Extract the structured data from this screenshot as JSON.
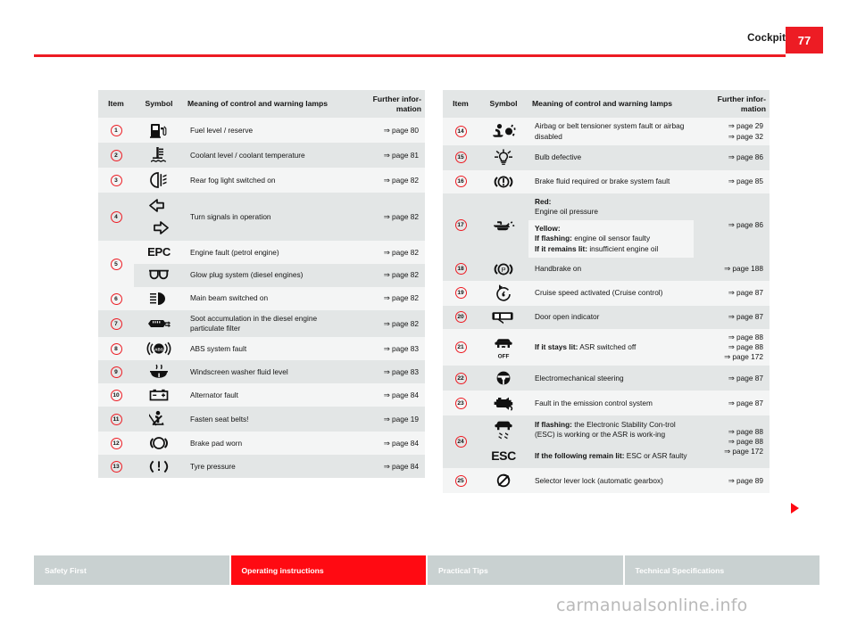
{
  "header": {
    "title": "Cockpit",
    "page_number": "77"
  },
  "columns": {
    "item": "Item",
    "symbol": "Symbol",
    "meaning": "Meaning of control and warning lamps",
    "further": "Further infor-\nmation",
    "further_line1": "Further infor-",
    "further_line2": "mation"
  },
  "left_rows": [
    {
      "item": "1",
      "icon": "fuel-pump-icon",
      "meaning": "Fuel level / reserve",
      "refs": [
        "⇒ page 80"
      ]
    },
    {
      "item": "2",
      "icon": "coolant-temp-icon",
      "meaning": "Coolant level / coolant temperature",
      "refs": [
        "⇒ page 81"
      ]
    },
    {
      "item": "3",
      "icon": "rear-fog-light-icon",
      "meaning": "Rear fog light switched on",
      "refs": [
        "⇒ page 82"
      ]
    },
    {
      "item": "4",
      "icon": "turn-signal-icon",
      "meaning": "Turn signals in operation",
      "refs": [
        "⇒ page 82"
      ]
    },
    {
      "item": "5",
      "icon": "epc-icon",
      "meaning": "Engine fault (petrol engine)",
      "refs": [
        "⇒ page 82"
      ]
    },
    {
      "item": "",
      "icon": "glow-plug-icon",
      "meaning": "Glow plug system (diesel engines)",
      "refs": [
        "⇒ page 82"
      ]
    },
    {
      "item": "6",
      "icon": "main-beam-icon",
      "meaning": "Main beam switched on",
      "refs": [
        "⇒ page 82"
      ]
    },
    {
      "item": "7",
      "icon": "particulate-filter-icon",
      "meaning": "Soot accumulation in the diesel engine particulate filter",
      "refs": [
        "⇒ page 82"
      ]
    },
    {
      "item": "8",
      "icon": "abs-icon",
      "meaning": "ABS system fault",
      "refs": [
        "⇒ page 83"
      ]
    },
    {
      "item": "9",
      "icon": "washer-fluid-icon",
      "meaning": "Windscreen washer fluid level",
      "refs": [
        "⇒ page 83"
      ]
    },
    {
      "item": "10",
      "icon": "alternator-icon",
      "meaning": "Alternator fault",
      "refs": [
        "⇒ page 84"
      ]
    },
    {
      "item": "11",
      "icon": "seat-belt-icon",
      "meaning": "Fasten seat belts!",
      "refs": [
        "⇒ page 19"
      ]
    },
    {
      "item": "12",
      "icon": "brake-pad-icon",
      "meaning": "Brake pad worn",
      "refs": [
        "⇒ page 84"
      ]
    },
    {
      "item": "13",
      "icon": "tyre-pressure-icon",
      "meaning": "Tyre pressure",
      "refs": [
        "⇒ page 84"
      ]
    }
  ],
  "right_rows": [
    {
      "item": "14",
      "icon": "airbag-icon",
      "meaning": "Airbag or belt tensioner system fault or airbag disabled",
      "refs": [
        "⇒ page 29",
        "⇒ page 32"
      ]
    },
    {
      "item": "15",
      "icon": "bulb-defective-icon",
      "meaning": "Bulb defective",
      "refs": [
        "⇒ page 86"
      ]
    },
    {
      "item": "16",
      "icon": "brake-fluid-icon",
      "meaning": "Brake fluid required or brake system fault",
      "refs": [
        "⇒ page 85"
      ]
    },
    {
      "item": "17",
      "icon": "oil-pressure-icon",
      "meaning": "",
      "refs": [
        "⇒ page 86"
      ]
    },
    {
      "item": "18",
      "icon": "handbrake-icon",
      "meaning": "Handbrake on",
      "refs": [
        "⇒ page 188"
      ]
    },
    {
      "item": "19",
      "icon": "cruise-control-icon",
      "meaning": "Cruise speed activated (Cruise control)",
      "refs": [
        "⇒ page 87"
      ]
    },
    {
      "item": "20",
      "icon": "door-open-icon",
      "meaning": "Door open indicator",
      "refs": [
        "⇒ page 87"
      ]
    },
    {
      "item": "21",
      "icon": "asr-off-icon",
      "meaning": "",
      "refs": [
        "⇒ page 88",
        "⇒ page 88",
        "⇒ page 172"
      ]
    },
    {
      "item": "22",
      "icon": "steering-icon",
      "meaning": "Electromechanical steering",
      "refs": [
        "⇒ page 87"
      ]
    },
    {
      "item": "23",
      "icon": "engine-emission-icon",
      "meaning": "Fault in the emission control system",
      "refs": [
        "⇒ page 87"
      ]
    },
    {
      "item": "24",
      "icon": "esc-skid-icon",
      "meaning": "",
      "refs": [
        "⇒ page 88",
        "⇒ page 88",
        "⇒ page 172"
      ]
    },
    {
      "item": "25",
      "icon": "selector-lever-icon",
      "meaning": "Selector lever lock (automatic gearbox)",
      "refs": [
        "⇒ page 89"
      ]
    }
  ],
  "oil_pressure_detail": {
    "red_label": "Red:",
    "red_text": "Engine oil pressure",
    "yellow_label": "Yellow:",
    "flashing_label": "If flashing:",
    "flashing_text": " engine oil sensor faulty",
    "lit_label": "If it remains lit:",
    "lit_text": " insufficient engine oil"
  },
  "asr_detail": {
    "label": "If it stays lit:",
    "text": " ASR switched off"
  },
  "esc_detail": {
    "flashing_label": "If flashing:",
    "flashing_text": " the Electronic Stability Con-trol (ESC) is working or the ASR is work-ing",
    "flashing_text_l1": " the Electronic Stability Con-",
    "flashing_text_l2": "trol (ESC) is working or the ASR is work-",
    "flashing_text_l3": "ing",
    "lit_label": "If the following remain lit:",
    "lit_text": " ESC or ASR faulty",
    "lit_text_l1": " ESC or ASR",
    "lit_text_l2": "faulty",
    "esc_symbol": "ESC"
  },
  "epc_symbol": "EPC",
  "asr_off_label": "OFF",
  "footer_tabs": [
    {
      "label": "Safety First",
      "active": false
    },
    {
      "label": "Operating instructions",
      "active": true
    },
    {
      "label": "Practical Tips",
      "active": false
    },
    {
      "label": "Technical Specifications",
      "active": false
    }
  ],
  "watermark": "carmanualsonline.info",
  "colors": {
    "accent_red": "#ed1c24",
    "bright_red": "#ff0a12",
    "row_light": "#f4f5f5",
    "row_dark": "#e3e6e6",
    "footer_gray": "#c9d1d1"
  }
}
